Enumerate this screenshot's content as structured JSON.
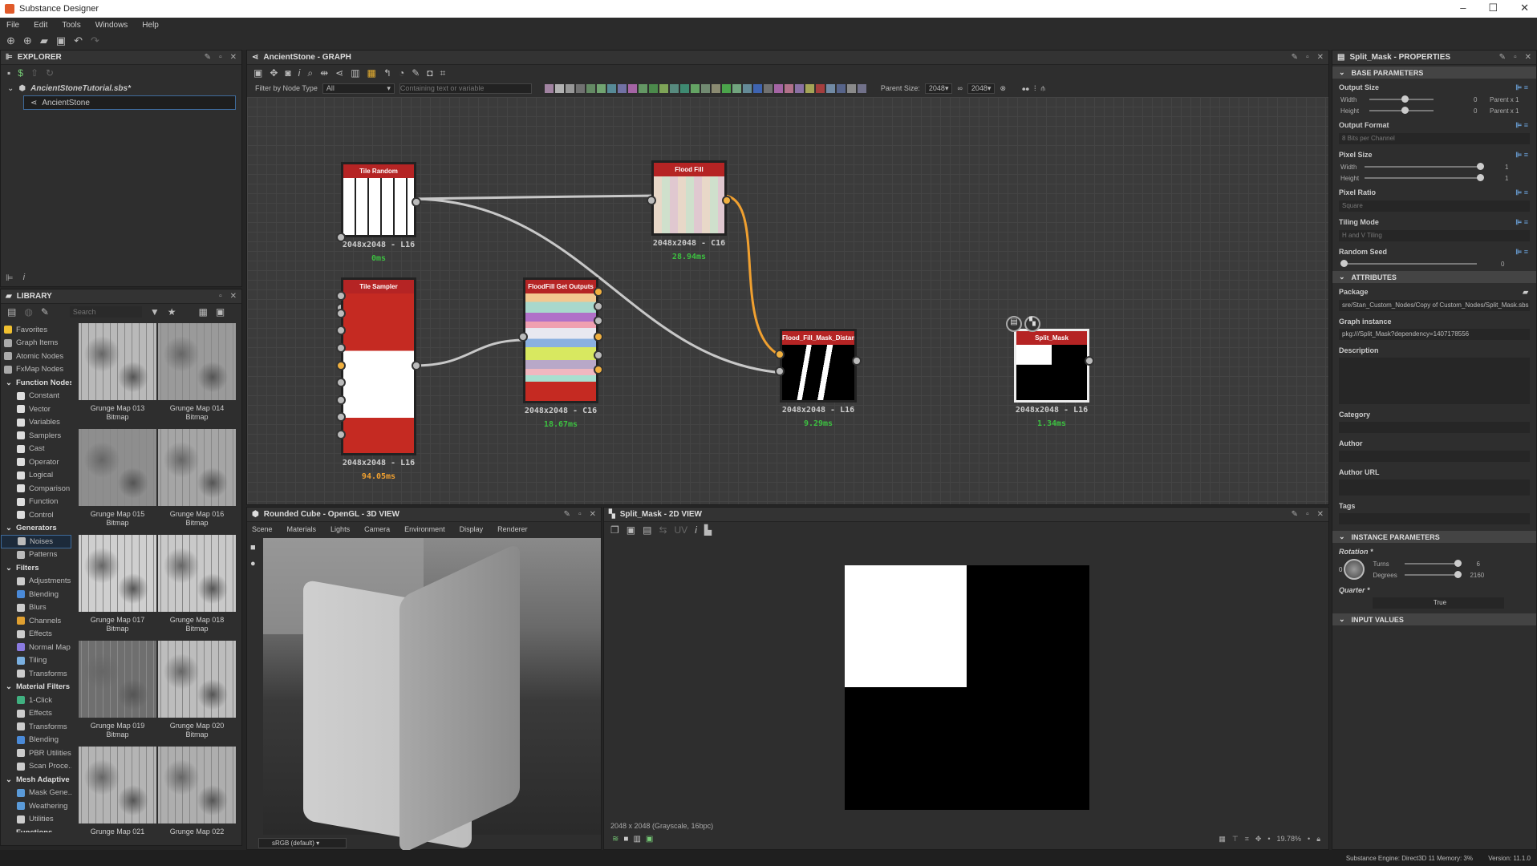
{
  "window": {
    "title": "Substance Designer",
    "controls": [
      "–",
      "☐",
      "✕"
    ]
  },
  "menu": [
    "File",
    "Edit",
    "Tools",
    "Windows",
    "Help"
  ],
  "explorer": {
    "title": "EXPLORER",
    "package": "AncientStoneTutorial.sbs*",
    "graph": "AncientStone"
  },
  "library": {
    "title": "LIBRARY",
    "search_placeholder": "Search",
    "tree": [
      {
        "label": "Favorites",
        "cat": false,
        "top": true,
        "color": "#f0c030"
      },
      {
        "label": "Graph Items",
        "top": true,
        "color": "#aaa"
      },
      {
        "label": "Atomic Nodes",
        "top": true,
        "color": "#aaa"
      },
      {
        "label": "FxMap Nodes",
        "top": true,
        "color": "#aaa"
      },
      {
        "label": "Function Nodes",
        "cat": true
      },
      {
        "label": "Constant",
        "color": "#ddd"
      },
      {
        "label": "Vector",
        "color": "#ddd"
      },
      {
        "label": "Variables",
        "color": "#ddd"
      },
      {
        "label": "Samplers",
        "color": "#ddd"
      },
      {
        "label": "Cast",
        "color": "#ddd"
      },
      {
        "label": "Operator",
        "color": "#ddd"
      },
      {
        "label": "Logical",
        "color": "#ddd"
      },
      {
        "label": "Comparison",
        "color": "#ddd"
      },
      {
        "label": "Function",
        "color": "#ddd"
      },
      {
        "label": "Control",
        "color": "#ddd"
      },
      {
        "label": "Generators",
        "cat": true
      },
      {
        "label": "Noises",
        "color": "#bbb",
        "selected": true
      },
      {
        "label": "Patterns",
        "color": "#bbb"
      },
      {
        "label": "Filters",
        "cat": true
      },
      {
        "label": "Adjustments",
        "color": "#ccc"
      },
      {
        "label": "Blending",
        "color": "#4a8ad8"
      },
      {
        "label": "Blurs",
        "color": "#ccc"
      },
      {
        "label": "Channels",
        "color": "#e0a030"
      },
      {
        "label": "Effects",
        "color": "#ccc"
      },
      {
        "label": "Normal Map",
        "color": "#8a7ae0"
      },
      {
        "label": "Tiling",
        "color": "#7ab0e0"
      },
      {
        "label": "Transforms",
        "color": "#ccc"
      },
      {
        "label": "Material Filters",
        "cat": true
      },
      {
        "label": "1-Click",
        "color": "#40b080"
      },
      {
        "label": "Effects",
        "color": "#ccc"
      },
      {
        "label": "Transforms",
        "color": "#ccc"
      },
      {
        "label": "Blending",
        "color": "#4a8ad8"
      },
      {
        "label": "PBR Utilities",
        "color": "#ccc"
      },
      {
        "label": "Scan Proce...",
        "color": "#ccc"
      },
      {
        "label": "Mesh Adaptive",
        "cat": true
      },
      {
        "label": "Mask Gene...",
        "color": "#5a9ad8"
      },
      {
        "label": "Weathering",
        "color": "#5a9ad8"
      },
      {
        "label": "Utilities",
        "color": "#ccc"
      },
      {
        "label": "Functions",
        "cat": true
      }
    ],
    "thumbs": [
      {
        "name": "Grunge Map 013",
        "type": "Bitmap"
      },
      {
        "name": "Grunge Map 014",
        "type": "Bitmap"
      },
      {
        "name": "Grunge Map 015",
        "type": "Bitmap"
      },
      {
        "name": "Grunge Map 016",
        "type": "Bitmap"
      },
      {
        "name": "Grunge Map 017",
        "type": "Bitmap"
      },
      {
        "name": "Grunge Map 018",
        "type": "Bitmap"
      },
      {
        "name": "Grunge Map 019",
        "type": "Bitmap"
      },
      {
        "name": "Grunge Map 020",
        "type": "Bitmap"
      },
      {
        "name": "Grunge Map 021",
        "type": ""
      },
      {
        "name": "Grunge Map 022",
        "type": ""
      }
    ]
  },
  "graph": {
    "title": "AncientStone - GRAPH",
    "filter_label": "Filter by Node Type",
    "filter_value": "All",
    "search_placeholder": "Containing text or variable",
    "parent_size_label": "Parent Size:",
    "parent_size_w": "2048",
    "parent_size_h": "2048",
    "nodes": [
      {
        "id": "tile-random",
        "title": "Tile Random",
        "info": "2048x2048 - L16",
        "time": "0ms",
        "time_color": "#3cc040"
      },
      {
        "id": "flood-fill",
        "title": "Flood Fill",
        "info": "2048x2048 - C16",
        "time": "28.94ms",
        "time_color": "#3cc040"
      },
      {
        "id": "tile-sampler",
        "title": "Tile Sampler",
        "info": "2048x2048 - L16",
        "time": "94.05ms",
        "time_color": "#f0a030"
      },
      {
        "id": "floodfill-get-outputs",
        "title": "FloodFill Get Outputs",
        "info": "2048x2048 - C16",
        "time": "18.67ms",
        "time_color": "#3cc040"
      },
      {
        "id": "flood-fill-mask-distance",
        "title": "Flood_Fill_Mask_Distance",
        "info": "2048x2048 - L16",
        "time": "9.29ms",
        "time_color": "#3cc040"
      },
      {
        "id": "split-mask",
        "title": "Split_Mask",
        "info": "2048x2048 - L16",
        "time": "1.34ms",
        "time_color": "#3cc040"
      }
    ]
  },
  "view3d": {
    "title": "Rounded Cube - OpenGL - 3D VIEW",
    "menu": [
      "Scene",
      "Materials",
      "Lights",
      "Camera",
      "Environment",
      "Display",
      "Renderer"
    ],
    "colorspace": "sRGB (default)"
  },
  "view2d": {
    "title": "Split_Mask - 2D VIEW",
    "image_info": "2048 x 2048 (Grayscale, 16bpc)",
    "zoom": "19.78%"
  },
  "properties": {
    "title": "Split_Mask - PROPERTIES",
    "base_title": "BASE PARAMETERS",
    "output_size": {
      "label": "Output Size",
      "width_label": "Width",
      "width_value": "0",
      "width_suffix": "Parent x 1",
      "width_level": 0.5,
      "height_label": "Height",
      "height_value": "0",
      "height_suffix": "Parent x 1",
      "height_level": 0.5
    },
    "output_format": {
      "label": "Output Format",
      "value": "8 Bits per Channel"
    },
    "pixel_size": {
      "label": "Pixel Size",
      "width_label": "Width",
      "width_value": "1",
      "height_label": "Height",
      "height_value": "1"
    },
    "pixel_ratio": {
      "label": "Pixel Ratio",
      "value": "Square"
    },
    "tiling_mode": {
      "label": "Tiling Mode",
      "value": "H and V Tiling"
    },
    "random_seed": {
      "label": "Random Seed",
      "value": "0"
    },
    "attributes_title": "ATTRIBUTES",
    "package": {
      "label": "Package",
      "value": "sre/Stan_Custom_Nodes/Copy of Custom_Nodes/Split_Mask.sbs"
    },
    "graph_instance": {
      "label": "Graph instance",
      "value": "pkg:///Split_Mask?dependency=1407178556"
    },
    "description_label": "Description",
    "category_label": "Category",
    "author_label": "Author",
    "author_url_label": "Author URL",
    "tags_label": "Tags",
    "instance_title": "INSTANCE PARAMETERS",
    "rotation": {
      "label": "Rotation *",
      "dial_value": "0",
      "turns_label": "Turns",
      "turns_value": "6",
      "degrees_label": "Degrees",
      "degrees_value": "2160"
    },
    "quarter": {
      "label": "Quarter *",
      "value": "True"
    },
    "input_title": "INPUT VALUES"
  },
  "status": {
    "engine": "Substance Engine: Direct3D 11  Memory: 3%",
    "version": "Version: 11.1.0"
  }
}
